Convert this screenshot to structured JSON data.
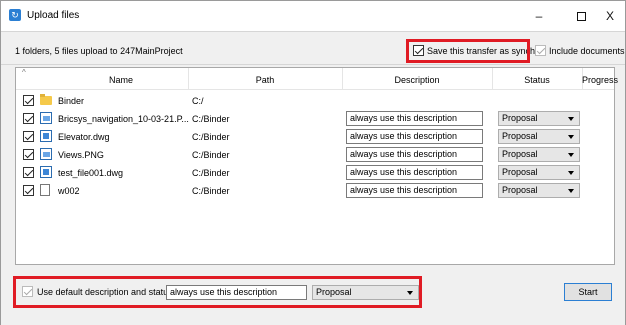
{
  "window": {
    "title": "Upload files",
    "minimize": "–",
    "close": "X"
  },
  "info": {
    "summary": "1 folders, 5 files upload to 247MainProject",
    "save_sync_label": "Save this transfer as synch",
    "include_docs_label": "Include documents"
  },
  "table": {
    "headers": {
      "name": "Name",
      "path": "Path",
      "description": "Description",
      "status": "Status",
      "progress": "Progress"
    },
    "rows": [
      {
        "name": "Binder",
        "path": "C:/",
        "icon": "folder-icon",
        "description": "",
        "status": ""
      },
      {
        "name": "Bricsys_navigation_10-03-21.P...",
        "path": "C:/Binder",
        "icon": "image-file-icon",
        "description": "always use this description",
        "status": "Proposal"
      },
      {
        "name": "Elevator.dwg",
        "path": "C:/Binder",
        "icon": "dwg-file-icon",
        "description": "always use this description",
        "status": "Proposal"
      },
      {
        "name": "Views.PNG",
        "path": "C:/Binder",
        "icon": "image-file-icon",
        "description": "always use this description",
        "status": "Proposal"
      },
      {
        "name": "test_file001.dwg",
        "path": "C:/Binder",
        "icon": "dwg-file-icon",
        "description": "always use this description",
        "status": "Proposal"
      },
      {
        "name": "w002",
        "path": "C:/Binder",
        "icon": "blank-file-icon",
        "description": "always use this description",
        "status": "Proposal"
      }
    ]
  },
  "defaults": {
    "checkbox_label": "Use default description and status",
    "description": "always use this description",
    "status": "Proposal"
  },
  "start_label": "Start",
  "colors": {
    "highlight": "#e01b24",
    "accent": "#2b7fd3"
  }
}
